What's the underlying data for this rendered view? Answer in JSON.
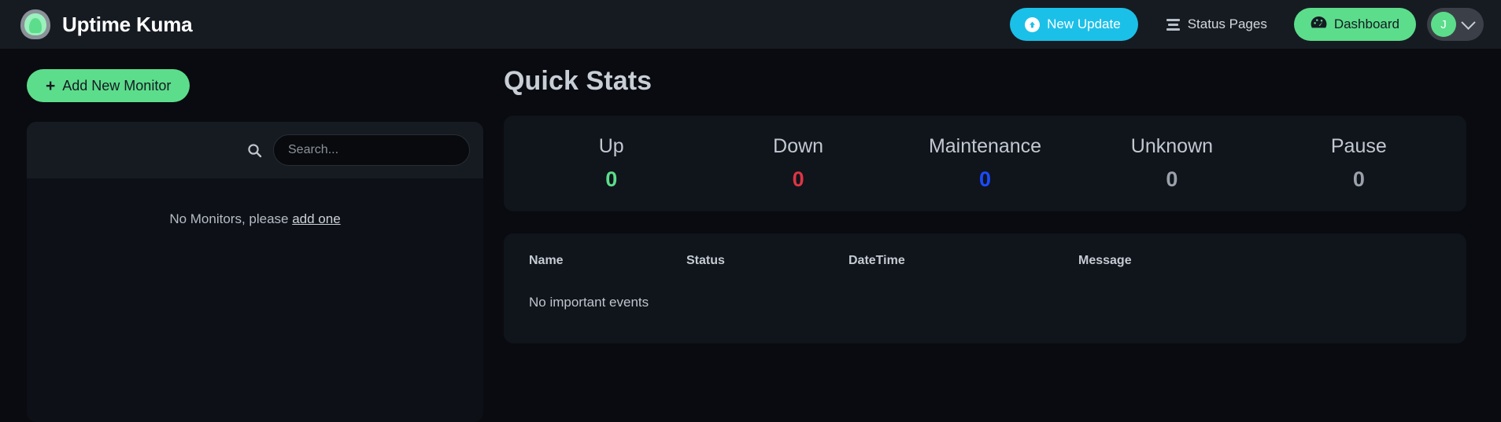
{
  "navbar": {
    "brand": "Uptime Kuma",
    "logo_icon": "uptime-kuma-logo",
    "new_update_label": "New Update",
    "new_update_icon": "upload-circle-icon",
    "new_update_color": "#1bc0e8",
    "status_pages_label": "Status Pages",
    "status_pages_icon": "bars-icon",
    "dashboard_label": "Dashboard",
    "dashboard_icon": "tachometer-icon",
    "dashboard_color": "#5cdd8b",
    "avatar_initial": "J",
    "chevron_icon": "chevron-down-icon"
  },
  "sidebar": {
    "add_monitor_label": "Add New Monitor",
    "add_monitor_icon": "plus-icon",
    "search_icon": "search-icon",
    "search_value": "",
    "search_placeholder": "Search...",
    "empty_text_prefix": "No Monitors, please ",
    "empty_link_label": "add one"
  },
  "main": {
    "title": "Quick Stats",
    "stats": [
      {
        "label": "Up",
        "value": "0",
        "color": "#5cdd8b"
      },
      {
        "label": "Down",
        "value": "0",
        "color": "#dc3545"
      },
      {
        "label": "Maintenance",
        "value": "0",
        "color": "#1a4bff"
      },
      {
        "label": "Unknown",
        "value": "0",
        "color": "#9aa1aa"
      },
      {
        "label": "Pause",
        "value": "0",
        "color": "#9aa1aa"
      }
    ],
    "events": {
      "columns": [
        "Name",
        "Status",
        "DateTime",
        "Message"
      ],
      "empty_text": "No important events"
    }
  }
}
